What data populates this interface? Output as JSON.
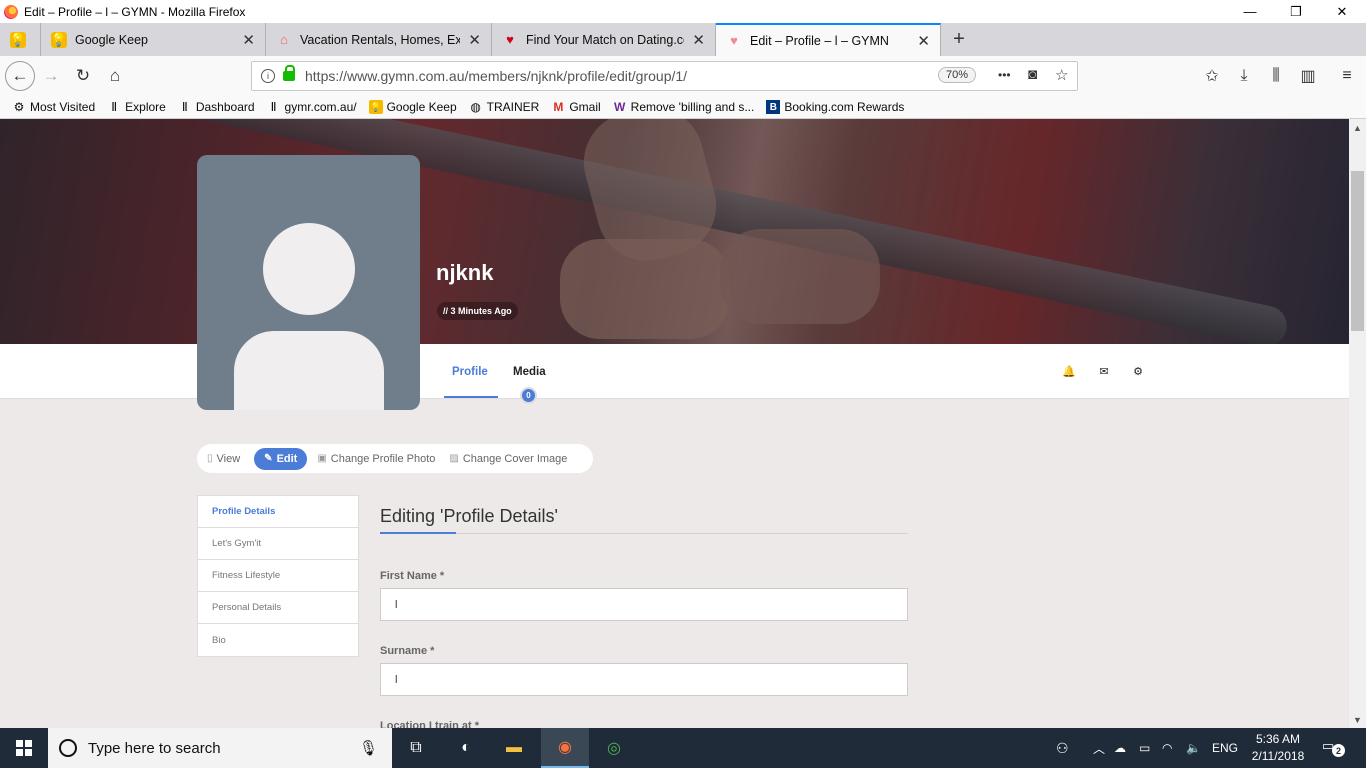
{
  "window": {
    "title": "Edit – Profile – l – GYMN - Mozilla Firefox",
    "minimize": "—",
    "restore": "❐",
    "close": "✕"
  },
  "tabs": [
    {
      "label": "Google Keep",
      "icon": "google-keep-icon",
      "active": false
    },
    {
      "label": "Vacation Rentals, Homes, Exper",
      "icon": "airbnb-icon",
      "active": false
    },
    {
      "label": "Find Your Match on Dating.con",
      "icon": "heart-icon",
      "active": false
    },
    {
      "label": "Edit – Profile – l – GYMN",
      "icon": "gymn-heart-icon",
      "active": true
    }
  ],
  "nav": {
    "url": "https://www.gymn.com.au/members/njknk/profile/edit/group/1/",
    "zoom": "70%",
    "more": "•••"
  },
  "bookmarks": [
    {
      "label": "Most Visited",
      "icon": "gear-icon"
    },
    {
      "label": "Explore",
      "icon": "dumbbell-icon"
    },
    {
      "label": "Dashboard",
      "icon": "dumbbell-icon"
    },
    {
      "label": "gymr.com.au/",
      "icon": "dumbbell-icon"
    },
    {
      "label": "Google Keep",
      "icon": "google-keep-icon"
    },
    {
      "label": "TRAINER",
      "icon": "globe-icon"
    },
    {
      "label": "Gmail",
      "icon": "gmail-icon"
    },
    {
      "label": "Remove 'billing and s...",
      "icon": "w-icon"
    },
    {
      "label": "Booking.com Rewards",
      "icon": "booking-icon"
    }
  ],
  "profile": {
    "name": "njknk",
    "last_active": "3 Minutes Ago",
    "tabs": {
      "profile": "Profile",
      "media": "Media",
      "media_count": "0"
    }
  },
  "actions": {
    "view": "View",
    "edit": "Edit",
    "change_photo": "Change Profile Photo",
    "change_cover": "Change Cover Image"
  },
  "side_menu": [
    {
      "label": "Profile Details",
      "active": true
    },
    {
      "label": "Let's Gym'it",
      "active": false
    },
    {
      "label": "Fitness Lifestyle",
      "active": false
    },
    {
      "label": "Personal Details",
      "active": false
    },
    {
      "label": "Bio",
      "active": false
    }
  ],
  "form": {
    "title": "Editing 'Profile Details'",
    "first_name_label": "First Name *",
    "first_name_value": "l",
    "surname_label": "Surname *",
    "surname_value": "l",
    "location_label": "Location I train at *"
  },
  "taskbar": {
    "search_placeholder": "Type here to search",
    "language": "ENG",
    "time": "5:36 AM",
    "date": "2/11/2018",
    "notifications": "2"
  },
  "colors": {
    "accent": "#4a7cd8",
    "firefox_tab_accent": "#0a84ff",
    "avatar_bg": "#707e8c",
    "taskbar": "#1f2b38"
  }
}
